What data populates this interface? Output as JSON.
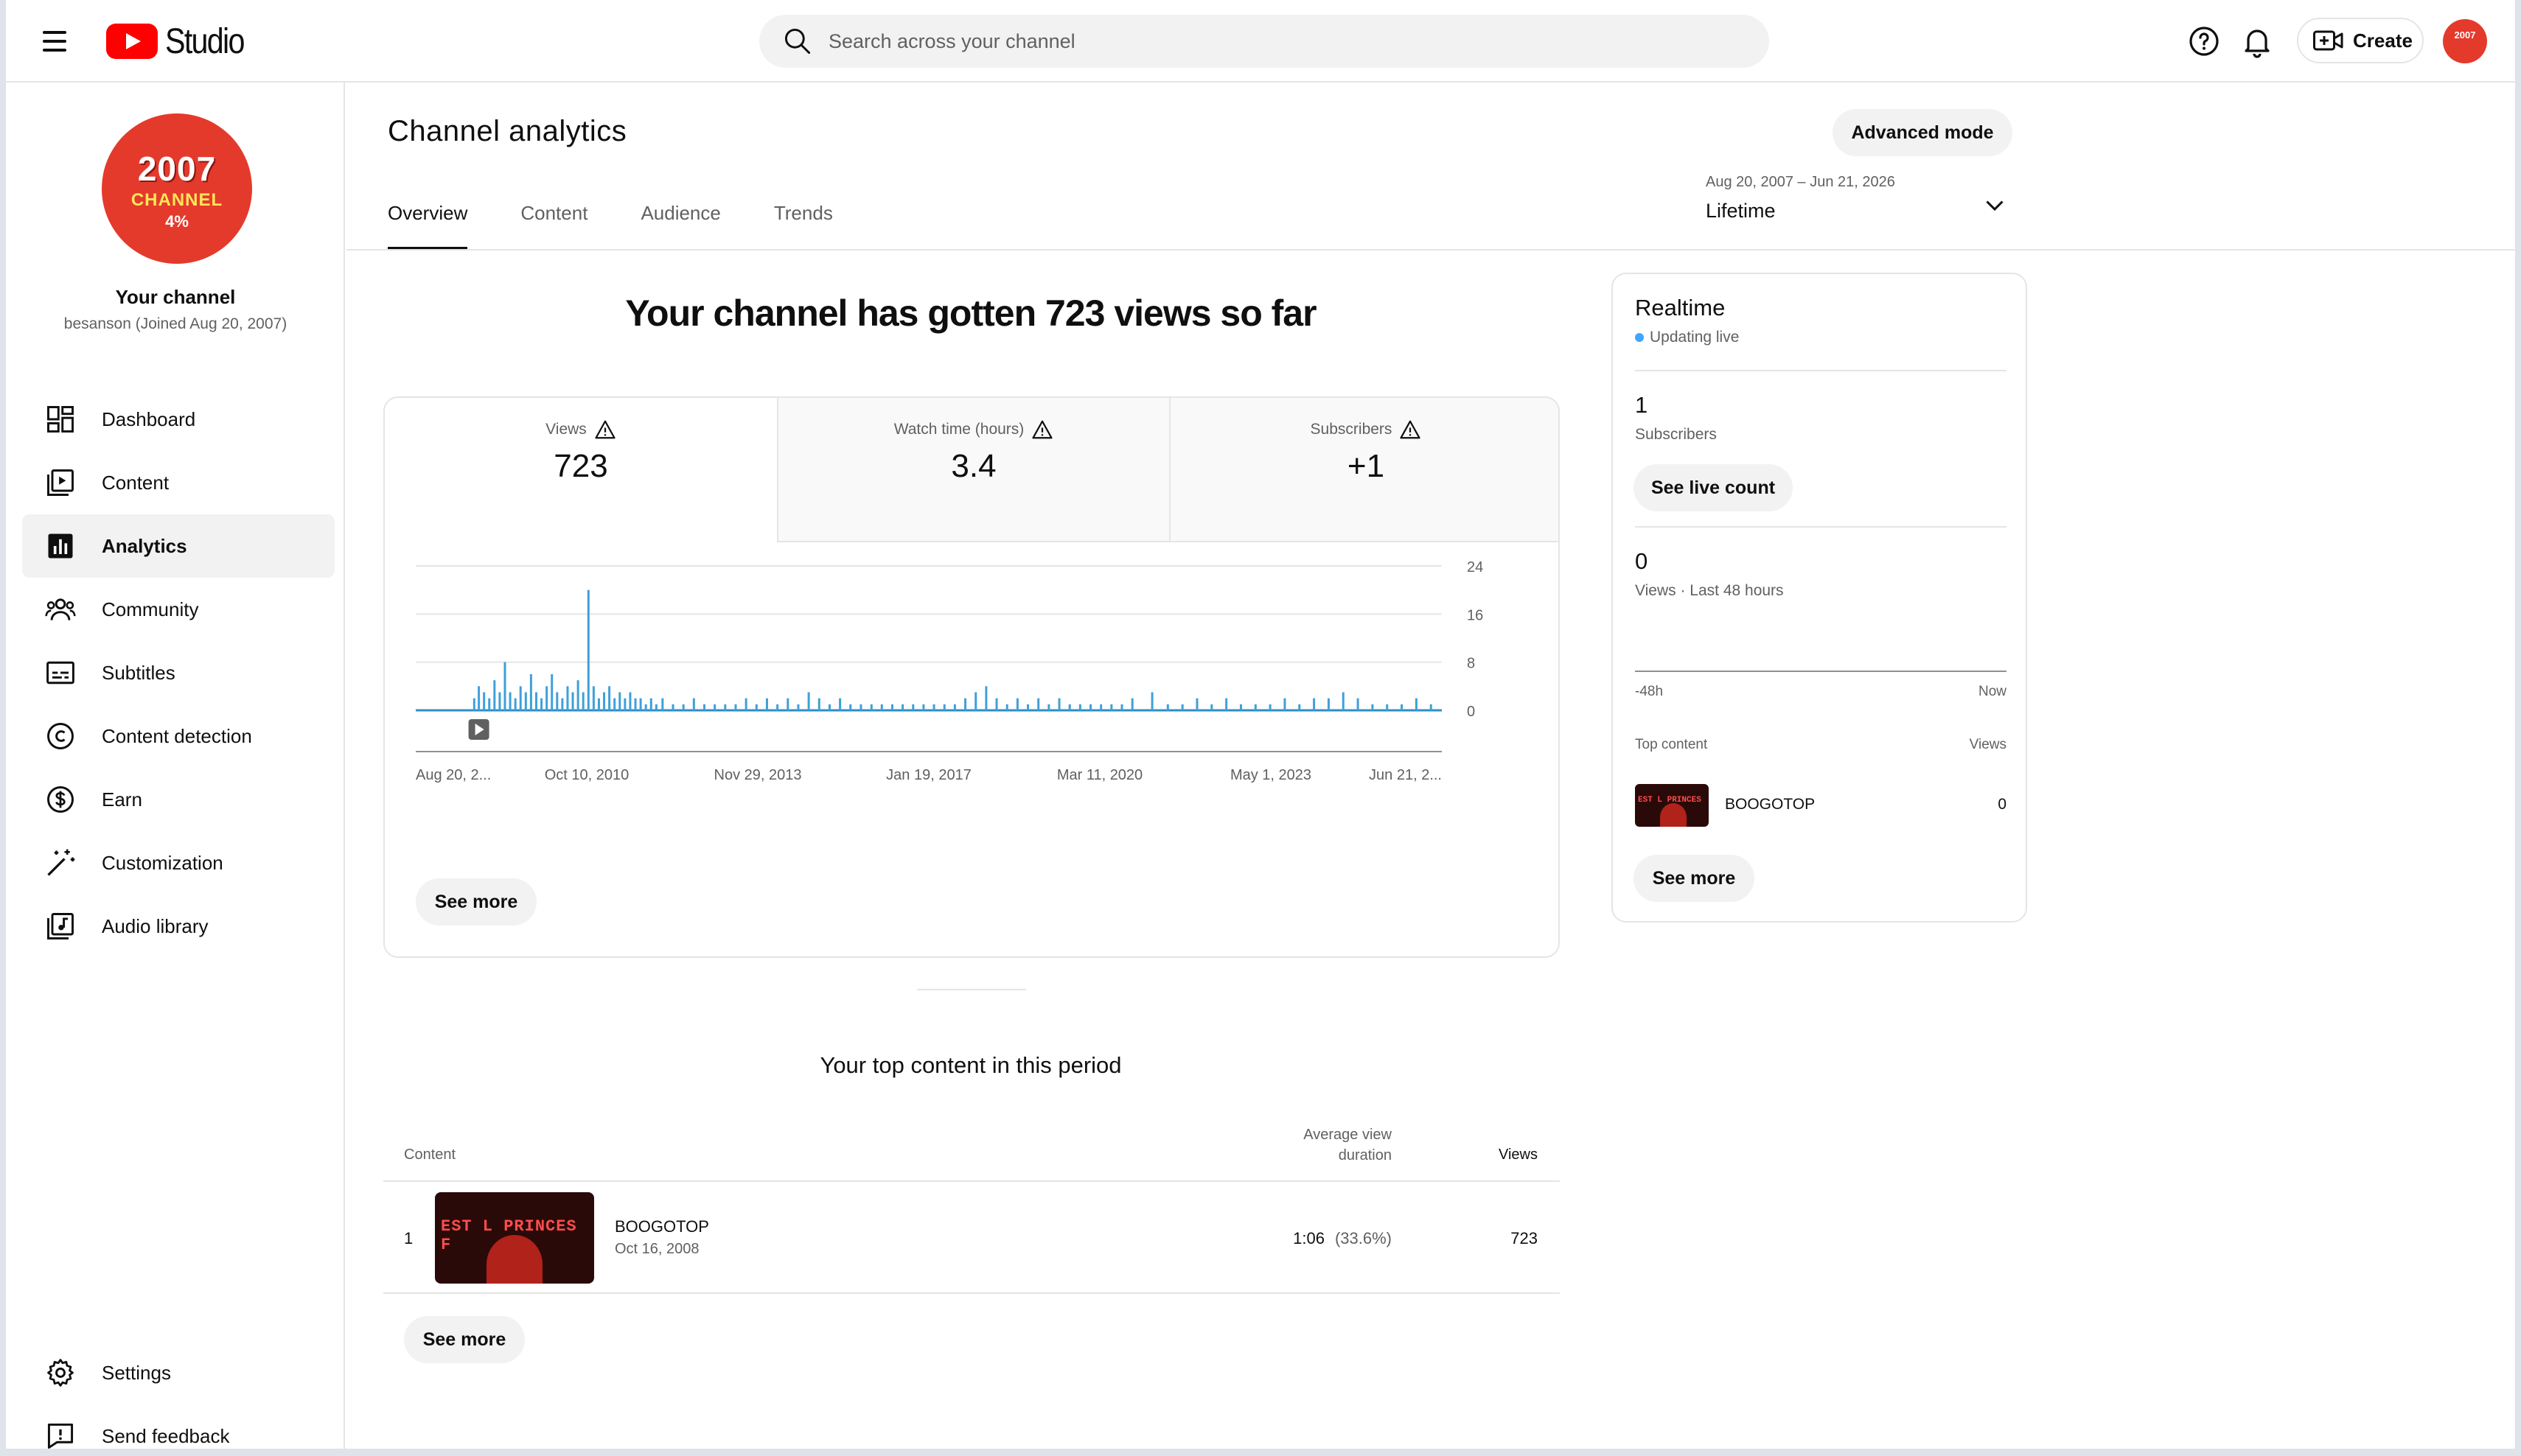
{
  "header": {
    "app_name": "Studio",
    "search_placeholder": "Search across your channel",
    "create_label": "Create",
    "avatar_text": "2007"
  },
  "sidebar": {
    "avatar": {
      "line1": "2007",
      "line2": "CHANNEL",
      "line3": "4%"
    },
    "channel_name": "Your channel",
    "channel_sub": "besanson (Joined Aug 20, 2007)",
    "items": [
      {
        "label": "Dashboard",
        "icon": "dashboard-icon"
      },
      {
        "label": "Content",
        "icon": "content-icon"
      },
      {
        "label": "Analytics",
        "icon": "analytics-icon",
        "active": true
      },
      {
        "label": "Community",
        "icon": "community-icon"
      },
      {
        "label": "Subtitles",
        "icon": "subtitles-icon"
      },
      {
        "label": "Content detection",
        "icon": "copyright-icon"
      },
      {
        "label": "Earn",
        "icon": "dollar-icon"
      },
      {
        "label": "Customization",
        "icon": "magic-wand-icon"
      },
      {
        "label": "Audio library",
        "icon": "audio-library-icon"
      }
    ],
    "bottom": [
      {
        "label": "Settings",
        "icon": "gear-icon"
      },
      {
        "label": "Send feedback",
        "icon": "feedback-icon"
      }
    ]
  },
  "main": {
    "title": "Channel analytics",
    "advanced_label": "Advanced mode",
    "tabs": [
      "Overview",
      "Content",
      "Audience",
      "Trends"
    ],
    "date_range": {
      "range": "Aug 20, 2007 – Jun 21, 2026",
      "label": "Lifetime"
    },
    "headline": "Your channel has gotten 723 views so far",
    "metrics": [
      {
        "label": "Views",
        "value": "723"
      },
      {
        "label": "Watch time (hours)",
        "value": "3.4"
      },
      {
        "label": "Subscribers",
        "value": "+1"
      }
    ],
    "see_more_label": "See more",
    "top_content": {
      "title": "Your top content in this period",
      "col_content": "Content",
      "col_avd_line1": "Average view",
      "col_avd_line2": "duration",
      "col_views": "Views",
      "rows": [
        {
          "rank": "1",
          "title": "BOOGOTOP",
          "date": "Oct 16, 2008",
          "thumb_text": "EST L PRINCES F",
          "avd": "1:06",
          "avd_pct": "(33.6%)",
          "views": "723"
        }
      ],
      "see_more_label": "See more"
    }
  },
  "realtime": {
    "title": "Realtime",
    "status": "Updating live",
    "subscribers_value": "1",
    "subscribers_label": "Subscribers",
    "see_live_label": "See live count",
    "views_value": "0",
    "views_label": "Views · Last 48 hours",
    "axis_start": "-48h",
    "axis_end": "Now",
    "top_content_label": "Top content",
    "views_col_label": "Views",
    "top_item": {
      "title": "BOOGOTOP",
      "views": "0",
      "thumb_text": "EST L PRINCES"
    },
    "see_more_label": "See more"
  },
  "chart_data": {
    "type": "bar",
    "title": "",
    "xlabel": "",
    "ylabel": "",
    "ylim": [
      0,
      24
    ],
    "y_ticks": [
      0,
      8,
      16,
      24
    ],
    "x_tick_labels": [
      "Aug 20, 2...",
      "Oct 10, 2010",
      "Nov 29, 2013",
      "Jan 19, 2017",
      "Mar 11, 2020",
      "May 1, 2023",
      "Jun 21, 2..."
    ],
    "x_range": [
      "2007-08-20",
      "2026-06-21"
    ],
    "series": [
      {
        "values": [
          {
            "x": "2008-09-15",
            "y": 2
          },
          {
            "x": "2008-10-16",
            "y": 4
          },
          {
            "x": "2008-11-20",
            "y": 3
          },
          {
            "x": "2008-12-25",
            "y": 2
          },
          {
            "x": "2009-01-29",
            "y": 5
          },
          {
            "x": "2009-03-05",
            "y": 3
          },
          {
            "x": "2009-04-09",
            "y": 8
          },
          {
            "x": "2009-05-14",
            "y": 3
          },
          {
            "x": "2009-06-18",
            "y": 2
          },
          {
            "x": "2009-07-23",
            "y": 4
          },
          {
            "x": "2009-08-27",
            "y": 3
          },
          {
            "x": "2009-10-01",
            "y": 6
          },
          {
            "x": "2009-11-05",
            "y": 3
          },
          {
            "x": "2009-12-10",
            "y": 2
          },
          {
            "x": "2010-01-14",
            "y": 4
          },
          {
            "x": "2010-02-18",
            "y": 6
          },
          {
            "x": "2010-03-25",
            "y": 3
          },
          {
            "x": "2010-04-29",
            "y": 2
          },
          {
            "x": "2010-06-03",
            "y": 4
          },
          {
            "x": "2010-07-08",
            "y": 3
          },
          {
            "x": "2010-08-12",
            "y": 5
          },
          {
            "x": "2010-09-16",
            "y": 3
          },
          {
            "x": "2010-10-21",
            "y": 20
          },
          {
            "x": "2010-11-25",
            "y": 4
          },
          {
            "x": "2010-12-30",
            "y": 2
          },
          {
            "x": "2011-02-03",
            "y": 3
          },
          {
            "x": "2011-03-10",
            "y": 4
          },
          {
            "x": "2011-04-14",
            "y": 2
          },
          {
            "x": "2011-05-19",
            "y": 3
          },
          {
            "x": "2011-06-23",
            "y": 2
          },
          {
            "x": "2011-07-28",
            "y": 3
          },
          {
            "x": "2011-09-01",
            "y": 2
          },
          {
            "x": "2011-10-06",
            "y": 2
          },
          {
            "x": "2011-11-10",
            "y": 1
          },
          {
            "x": "2011-12-15",
            "y": 2
          },
          {
            "x": "2012-01-19",
            "y": 1
          },
          {
            "x": "2012-03-01",
            "y": 2
          },
          {
            "x": "2012-05-10",
            "y": 1
          },
          {
            "x": "2012-07-19",
            "y": 1
          },
          {
            "x": "2012-09-27",
            "y": 2
          },
          {
            "x": "2012-12-06",
            "y": 1
          },
          {
            "x": "2013-02-14",
            "y": 1
          },
          {
            "x": "2013-04-25",
            "y": 1
          },
          {
            "x": "2013-07-04",
            "y": 1
          },
          {
            "x": "2013-09-12",
            "y": 2
          },
          {
            "x": "2013-11-21",
            "y": 1
          },
          {
            "x": "2014-01-30",
            "y": 2
          },
          {
            "x": "2014-04-10",
            "y": 1
          },
          {
            "x": "2014-06-19",
            "y": 2
          },
          {
            "x": "2014-08-28",
            "y": 1
          },
          {
            "x": "2014-11-06",
            "y": 3
          },
          {
            "x": "2015-01-15",
            "y": 2
          },
          {
            "x": "2015-03-26",
            "y": 1
          },
          {
            "x": "2015-06-04",
            "y": 2
          },
          {
            "x": "2015-08-13",
            "y": 1
          },
          {
            "x": "2015-10-22",
            "y": 1
          },
          {
            "x": "2016-01-01",
            "y": 1
          },
          {
            "x": "2016-03-10",
            "y": 1
          },
          {
            "x": "2016-05-19",
            "y": 1
          },
          {
            "x": "2016-07-28",
            "y": 1
          },
          {
            "x": "2016-10-06",
            "y": 1
          },
          {
            "x": "2016-12-15",
            "y": 1
          },
          {
            "x": "2017-02-23",
            "y": 1
          },
          {
            "x": "2017-05-04",
            "y": 1
          },
          {
            "x": "2017-07-13",
            "y": 1
          },
          {
            "x": "2017-09-21",
            "y": 2
          },
          {
            "x": "2017-11-30",
            "y": 3
          },
          {
            "x": "2018-02-08",
            "y": 4
          },
          {
            "x": "2018-04-19",
            "y": 2
          },
          {
            "x": "2018-06-28",
            "y": 1
          },
          {
            "x": "2018-09-06",
            "y": 2
          },
          {
            "x": "2018-11-15",
            "y": 1
          },
          {
            "x": "2019-01-24",
            "y": 2
          },
          {
            "x": "2019-04-04",
            "y": 1
          },
          {
            "x": "2019-06-13",
            "y": 2
          },
          {
            "x": "2019-08-22",
            "y": 1
          },
          {
            "x": "2019-10-31",
            "y": 1
          },
          {
            "x": "2020-01-09",
            "y": 1
          },
          {
            "x": "2020-03-19",
            "y": 1
          },
          {
            "x": "2020-05-28",
            "y": 1
          },
          {
            "x": "2020-08-06",
            "y": 1
          },
          {
            "x": "2020-10-15",
            "y": 2
          },
          {
            "x": "2021-02-25",
            "y": 3
          },
          {
            "x": "2021-06-10",
            "y": 1
          },
          {
            "x": "2021-09-16",
            "y": 1
          },
          {
            "x": "2021-12-23",
            "y": 2
          },
          {
            "x": "2022-03-31",
            "y": 1
          },
          {
            "x": "2022-07-07",
            "y": 2
          },
          {
            "x": "2022-10-13",
            "y": 1
          },
          {
            "x": "2023-01-19",
            "y": 1
          },
          {
            "x": "2023-04-27",
            "y": 1
          },
          {
            "x": "2023-08-03",
            "y": 2
          },
          {
            "x": "2023-11-09",
            "y": 1
          },
          {
            "x": "2024-02-15",
            "y": 2
          },
          {
            "x": "2024-05-23",
            "y": 2
          },
          {
            "x": "2024-08-29",
            "y": 3
          },
          {
            "x": "2024-12-05",
            "y": 2
          },
          {
            "x": "2025-03-13",
            "y": 1
          },
          {
            "x": "2025-06-19",
            "y": 1
          },
          {
            "x": "2025-09-25",
            "y": 1
          },
          {
            "x": "2026-01-01",
            "y": 2
          },
          {
            "x": "2026-04-09",
            "y": 1
          }
        ]
      }
    ],
    "marker_date": "2008-10-16",
    "grid": true,
    "legend": "none"
  }
}
